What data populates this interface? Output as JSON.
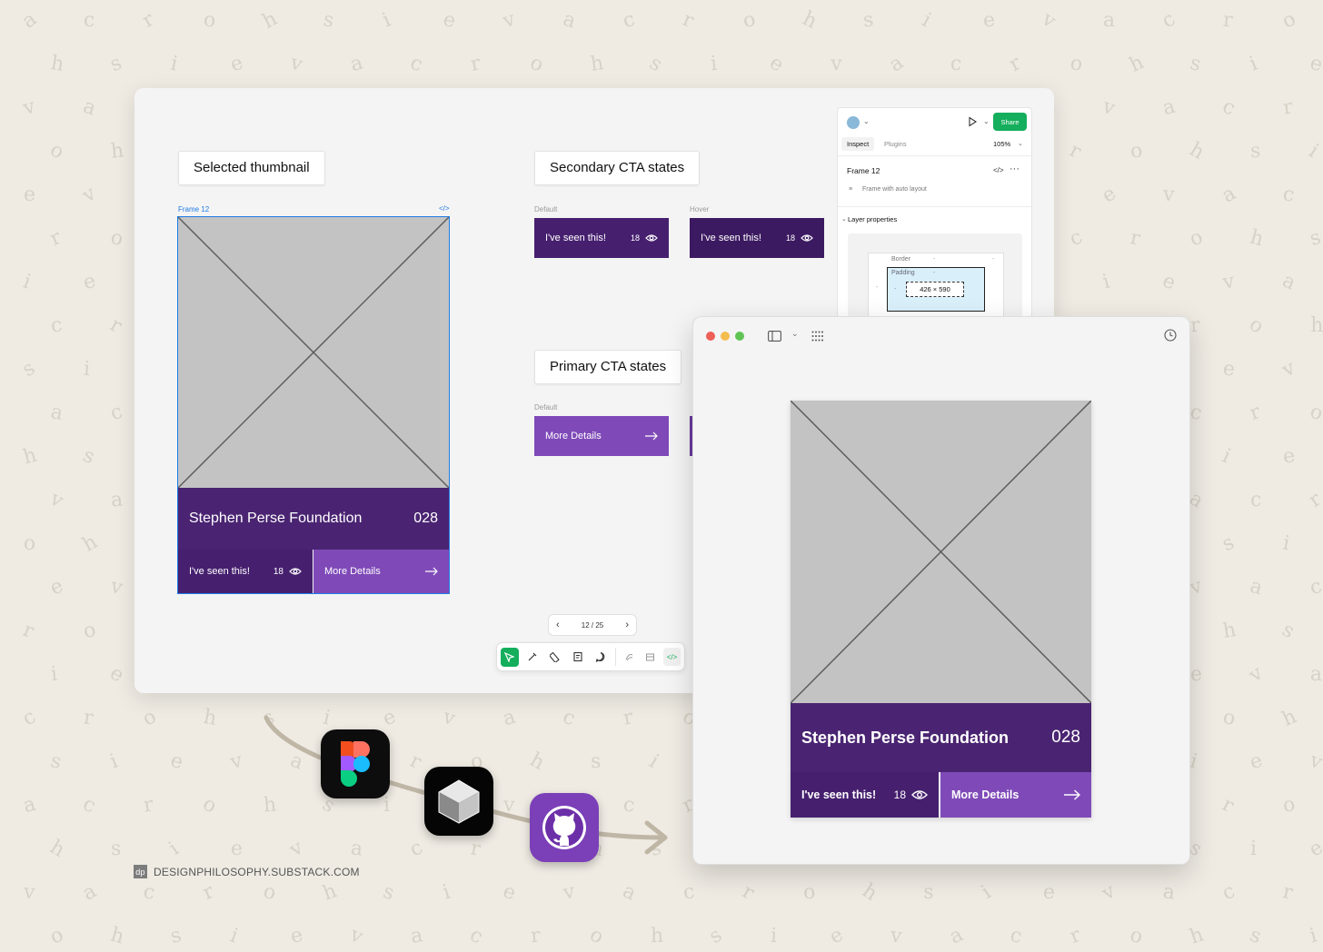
{
  "canvas": {
    "selected_thumbnail_label": "Selected thumbnail",
    "secondary_cta_label": "Secondary CTA states",
    "primary_cta_label": "Primary CTA states",
    "frame_name": "Frame 12",
    "code_glyph": "</>",
    "state_default": "Default",
    "state_hover": "Hover",
    "pager": "12 / 25"
  },
  "card": {
    "title": "Stephen Perse Foundation",
    "number": "028",
    "seen_label": "I've seen this!",
    "seen_count": "18",
    "more_label": "More Details"
  },
  "inspect": {
    "share": "Share",
    "tab_inspect": "Inspect",
    "tab_plugins": "Plugins",
    "zoom": "105%",
    "frame_title": "Frame 12",
    "frame_sub": "Frame with auto layout",
    "layer_props": "Layer properties",
    "border": "Border",
    "padding": "Padding",
    "dims": "426 × 590",
    "dash": "-"
  },
  "footer": {
    "badge": "dp",
    "site": "DESIGNPHILOSOPHY.SUBSTACK.COM"
  },
  "colors": {
    "purple_dark": "#46206f",
    "purple_title": "#4a2472",
    "purple_light": "#7f4ab8",
    "share_green": "#14ae5c",
    "selection_blue": "#1e7be8"
  }
}
